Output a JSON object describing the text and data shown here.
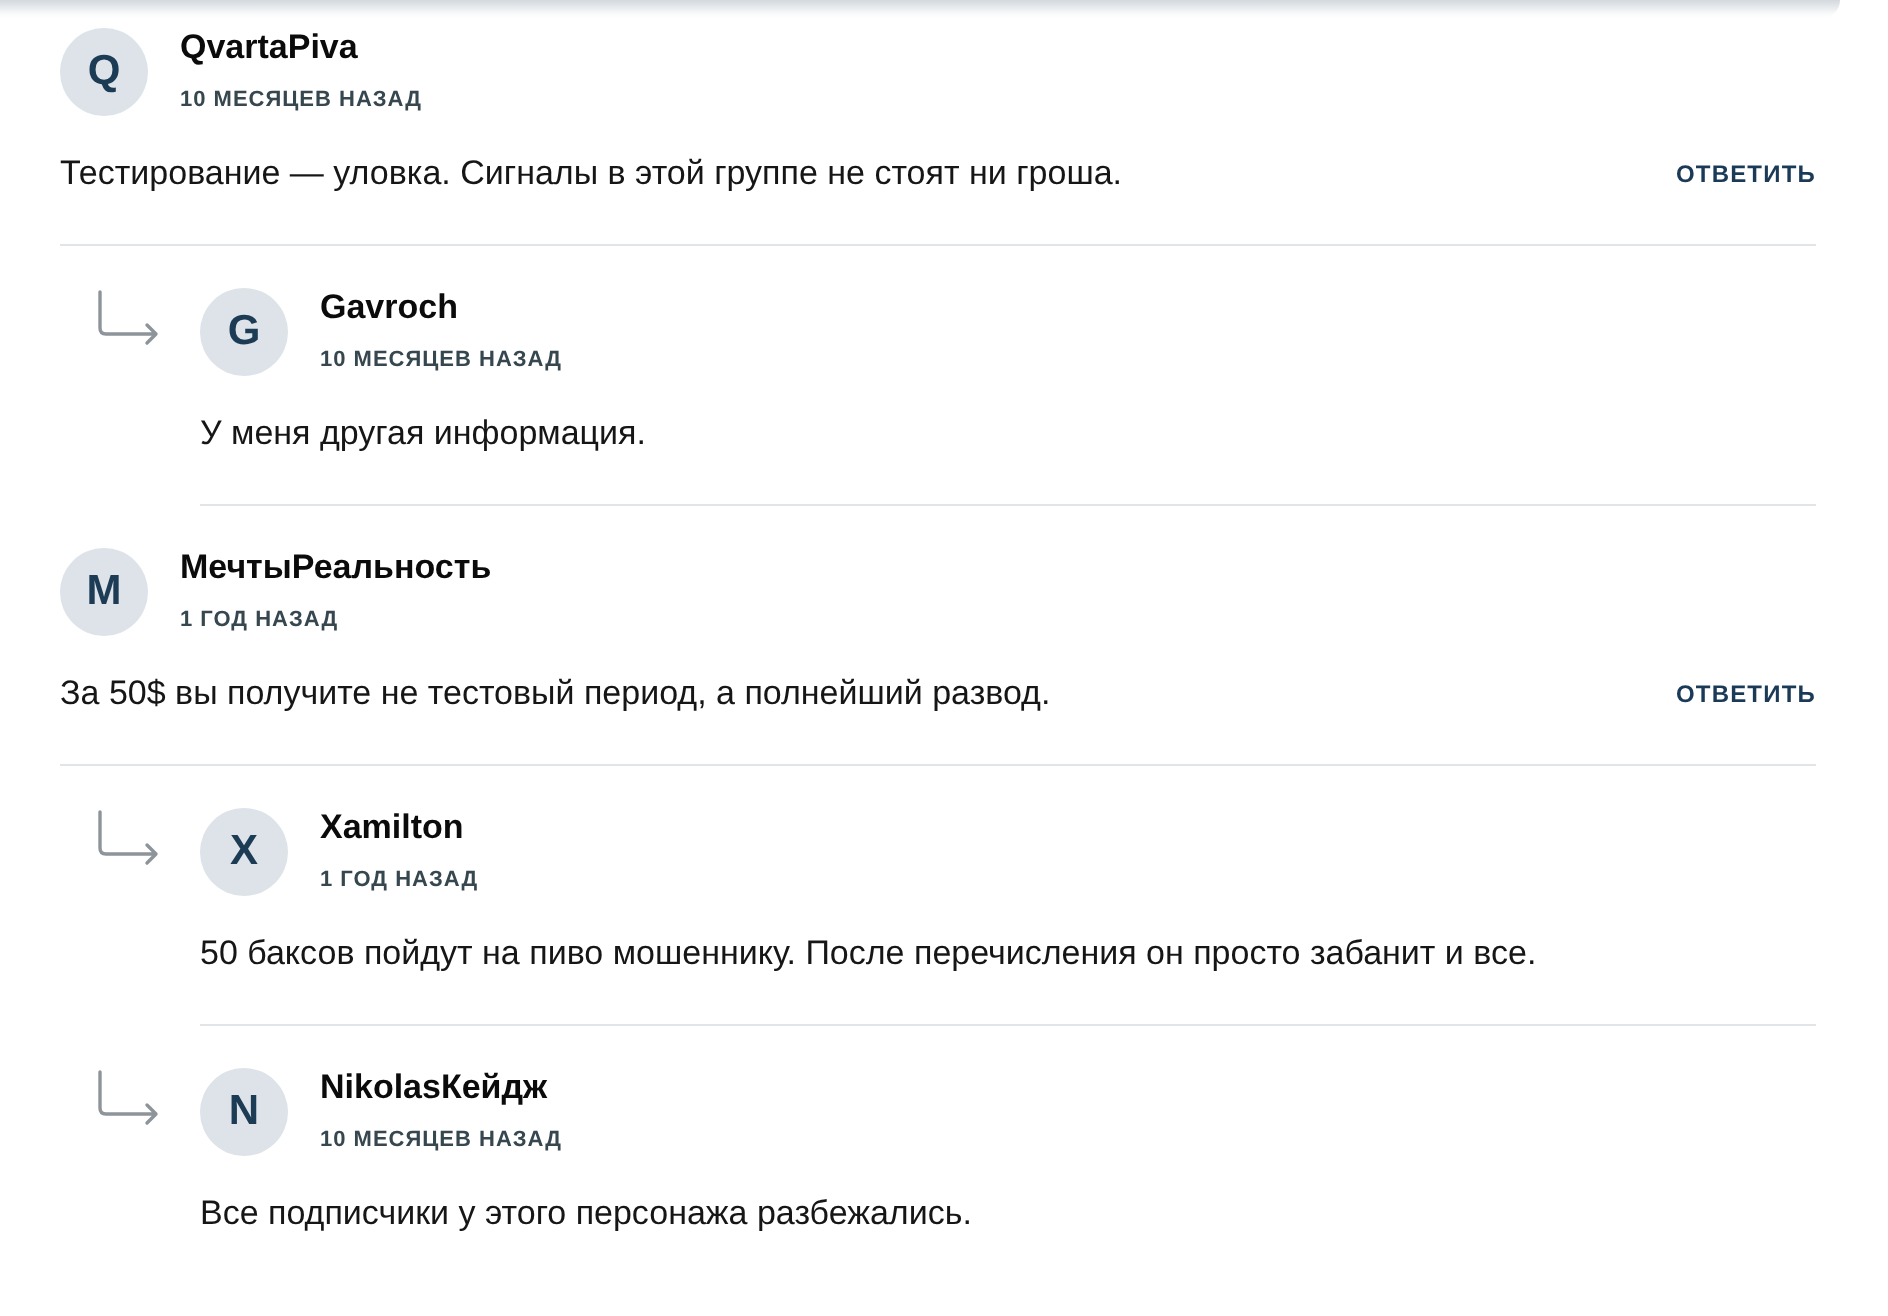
{
  "comments": [
    {
      "initial": "Q",
      "author": "QvartaPiva",
      "time": "10 МЕСЯЦЕВ НАЗАД",
      "text": "Тестирование — уловка. Сигналы в этой группе не стоят ни гроша.",
      "reply_button": "ОТВЕТИТЬ",
      "replies": [
        {
          "initial": "G",
          "author": "Gavroch",
          "time": "10 МЕСЯЦЕВ НАЗАД",
          "text": "У меня другая информация."
        }
      ]
    },
    {
      "initial": "M",
      "author": "МечтыРеальность",
      "time": "1 ГОД НАЗАД",
      "text": "За 50$ вы получите не тестовый период, а полнейший развод.",
      "reply_button": "ОТВЕТИТЬ",
      "replies": [
        {
          "initial": "X",
          "author": "Xamilton",
          "time": "1 ГОД НАЗАД",
          "text": "50 баксов пойдут на пиво мошеннику. После перечисления он просто забанит и все."
        },
        {
          "initial": "N",
          "author": "NikolasКейдж",
          "time": "10 МЕСЯЦЕВ НАЗАД",
          "text": "Все подписчики у этого персонажа разбежались."
        }
      ]
    }
  ]
}
